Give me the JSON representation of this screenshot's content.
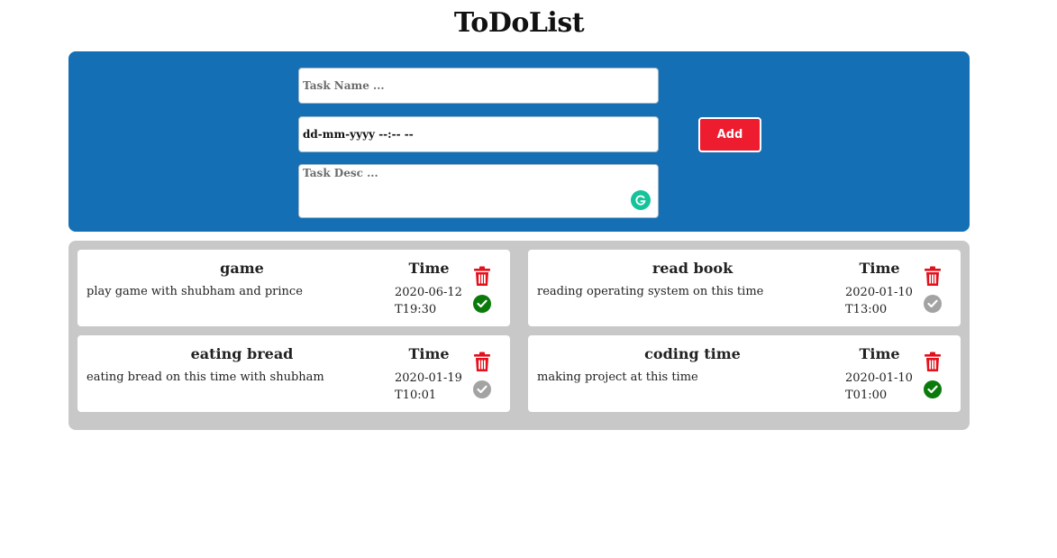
{
  "app": {
    "title": "ToDoList"
  },
  "form": {
    "task_name_placeholder": "Task Name ...",
    "date_value": "dd-mm-yyyy --:-- --",
    "task_desc_placeholder": "Task Desc ...",
    "add_label": "Add"
  },
  "tasks": [
    {
      "title": "game",
      "description": "play game with shubham and prince",
      "time_label": "Time",
      "time": "2020-06-12T19:30",
      "done": true
    },
    {
      "title": "read book",
      "description": "reading operating system on this time",
      "time_label": "Time",
      "time": "2020-01-10T13:00",
      "done": false
    },
    {
      "title": "eating bread",
      "description": "eating bread on this time with shubham",
      "time_label": "Time",
      "time": "2020-01-19T10:01",
      "done": false
    },
    {
      "title": "coding time",
      "description": "making project at this time",
      "time_label": "Time",
      "time": "2020-01-10T01:00",
      "done": true
    }
  ],
  "colors": {
    "form_bg": "#146fb4",
    "add_button": "#ed1c2f",
    "list_bg": "#c8c8c8",
    "trash": "#e4101c",
    "done": "#0a7a0a",
    "pending": "#a3a3a3"
  },
  "icons": {
    "delete": "trash-icon",
    "status_done": "check-circle-icon",
    "status_pending": "check-circle-icon",
    "grammarly": "grammarly-icon"
  }
}
